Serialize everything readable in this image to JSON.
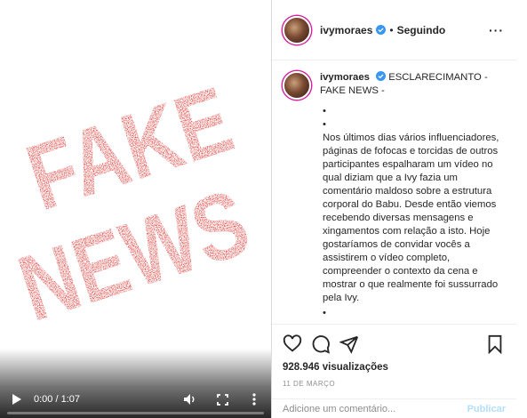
{
  "media": {
    "stamp_line1": "FAKE",
    "stamp_line2": "NEWS",
    "stamp_color": "#d7231f",
    "controls": {
      "time": "0:00 / 1:07",
      "progress": 0,
      "play_icon": "play-icon",
      "volume_icon": "volume-icon",
      "fullscreen_icon": "fullscreen-icon",
      "menu_icon": "more-vertical-icon"
    }
  },
  "header": {
    "username": "ivymoraes",
    "separator": "•",
    "follow_label": "Seguindo",
    "more_label": "···"
  },
  "caption": {
    "username": "ivymoraes",
    "title": "ESCLARECIMANTO - FAKE NEWS -",
    "bullet": "•",
    "body": "Nos últimos dias vários influenciadores, páginas de fofocas e torcidas de outros participantes espalharam um vídeo no qual diziam que a Ivy fazia um comentário maldoso sobre a estrutura corporal do Babu. Desde então viemos recebendo diversas mensagens e xingamentos com relação a isto. Hoje gostaríamos de convidar vocês a assistirem o vídeo completo, compreender o contexto da cena e mostrar o que realmente foi sussurrado pela Ivy."
  },
  "actions": {
    "views": "928.946 visualizações",
    "date": "11 DE MARÇO"
  },
  "comment": {
    "placeholder": "Adicione um comentário...",
    "publish_label": "Publicar"
  },
  "colors": {
    "verified": "#3897f0",
    "publish_disabled": "#b2dffc",
    "border": "#efefef"
  }
}
